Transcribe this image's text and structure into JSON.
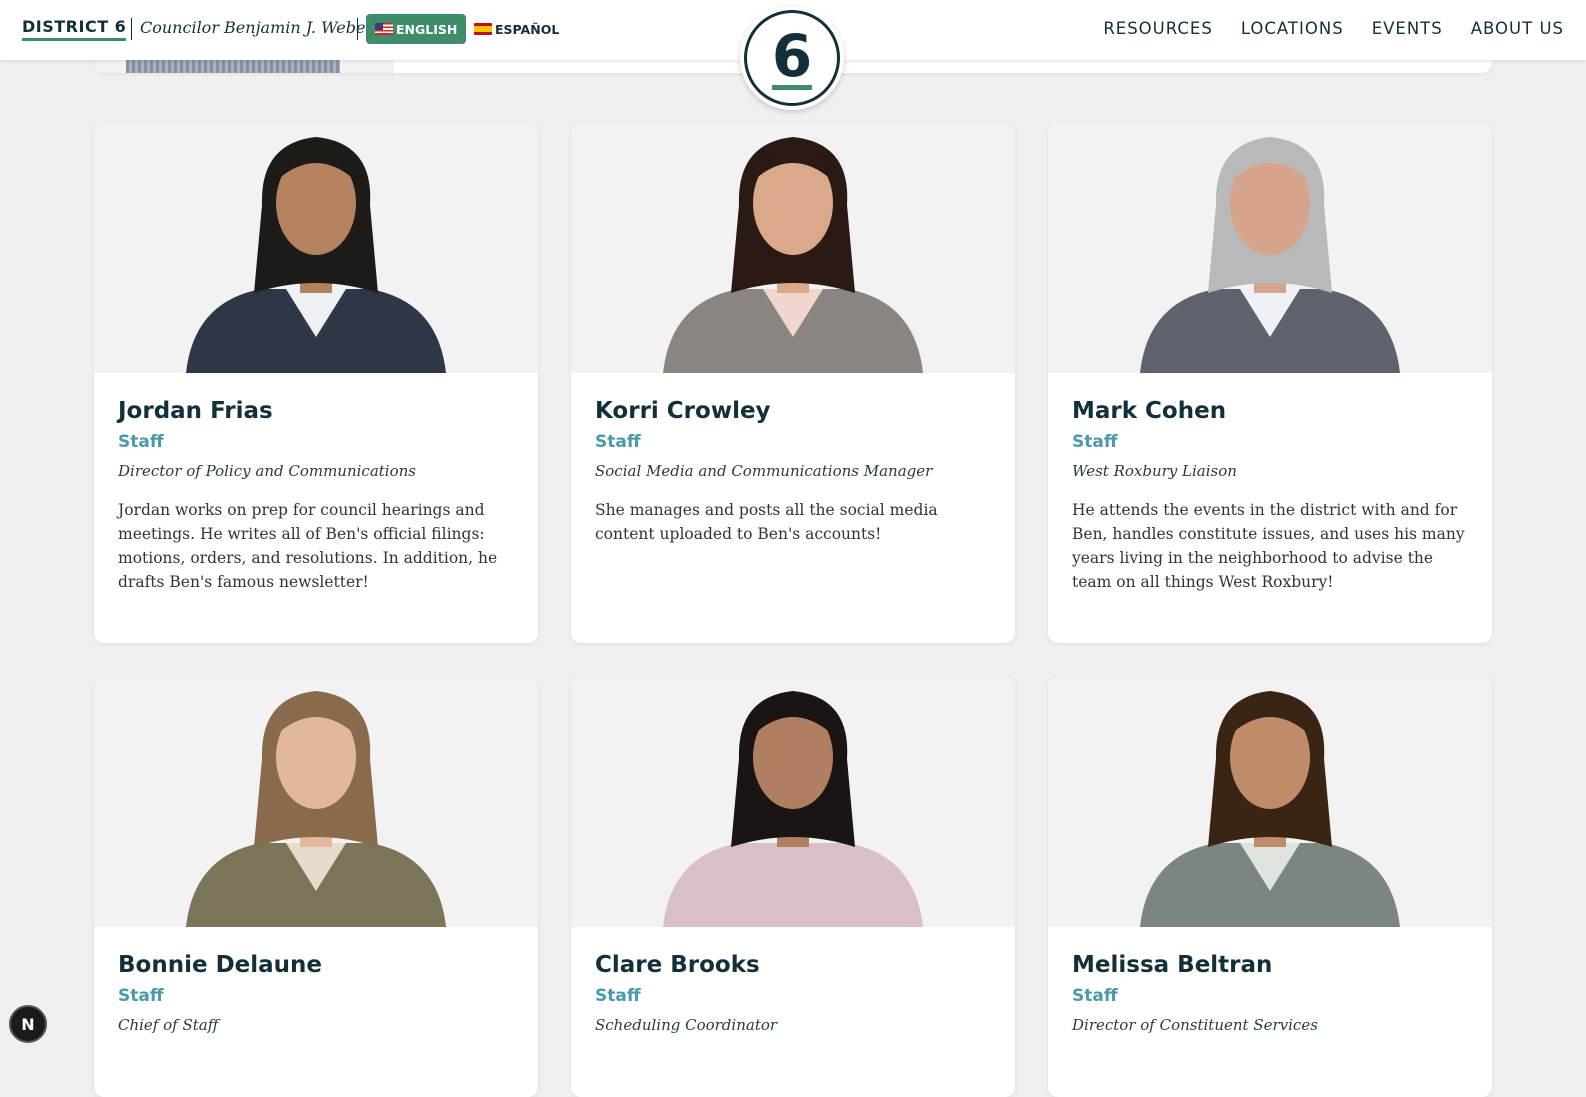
{
  "header": {
    "brand": "DISTRICT 6",
    "councilor": "Councilor Benjamin J. Weber",
    "lang_english": "ENGLISH",
    "lang_spanish": "ESPAÑOL",
    "badge_number": "6",
    "nav": [
      "RESOURCES",
      "LOCATIONS",
      "EVENTS",
      "ABOUT US"
    ]
  },
  "staff": [
    {
      "name": "Jordan Frias",
      "role": "Staff",
      "title": "Director of Policy and Communications",
      "bio": "Jordan works on prep for council hearings and meetings. He writes all of Ben's official filings: motions, orders, and resolutions. In addition, he drafts Ben's famous newsletter!",
      "hair": "#1e1a17",
      "skin": "#b4825f",
      "shirt": "#2e3746",
      "accent": "#eef0f4"
    },
    {
      "name": "Korri Crowley",
      "role": "Staff",
      "title": "Social Media and Communications Manager",
      "bio": "She manages and posts all the social media content uploaded to Ben's accounts!",
      "hair": "#2b1a14",
      "skin": "#d9a98a",
      "shirt": "#8a8580",
      "accent": "#f0d6cf"
    },
    {
      "name": "Mark Cohen",
      "role": "Staff",
      "title": "West Roxbury Liaison",
      "bio": "He attends the events in the district with and for Ben, handles constitute issues, and uses his many years living in the neighborhood to advise the team on all things West Roxbury!",
      "hair": "#b9b9b9",
      "skin": "#d6a48c",
      "shirt": "#5d626c",
      "accent": "#eef1f6"
    },
    {
      "name": "Bonnie Delaune",
      "role": "Staff",
      "title": "Chief of Staff",
      "bio": "",
      "hair": "#8a6a4c",
      "skin": "#e2b79c",
      "shirt": "#7a7559",
      "accent": "#e6dccd"
    },
    {
      "name": "Clare Brooks",
      "role": "Staff",
      "title": "Scheduling Coordinator",
      "bio": "",
      "hair": "#1a1412",
      "skin": "#b07f62",
      "shirt": "#d8c0c4",
      "accent": "#d8c0c4"
    },
    {
      "name": "Melissa Beltran",
      "role": "Staff",
      "title": "Director of Constituent Services",
      "bio": "",
      "hair": "#3a2414",
      "skin": "#c08b68",
      "shirt": "#7c8680",
      "accent": "#dfe3df"
    }
  ]
}
